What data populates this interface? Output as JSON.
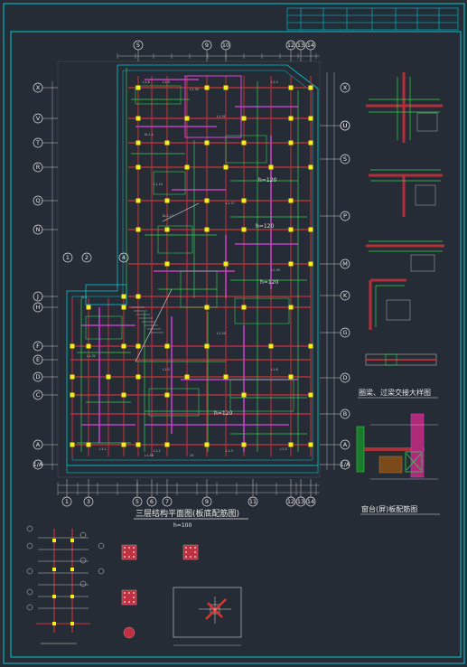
{
  "drawing": {
    "main_title": "三层结构平面图(板底配筋图)",
    "main_note": "h=100",
    "detail_title_1": "圈梁、过梁交接大样图",
    "detail_title_2": "窗台(屏)板配筋图",
    "slab_labels": [
      "h=120",
      "h=120",
      "h=120",
      "h=120"
    ]
  },
  "grid": {
    "top_axes": [
      "5",
      "9",
      "10",
      "12",
      "13",
      "14"
    ],
    "bottom_axes": [
      "1",
      "3",
      "5",
      "6",
      "7",
      "9",
      "11",
      "12",
      "13",
      "14"
    ],
    "left_axes": [
      "X",
      "V",
      "T",
      "R",
      "Q",
      "N",
      "J",
      "H",
      "F",
      "E",
      "D",
      "C",
      "A",
      "1/A"
    ],
    "right_axes": [
      "U",
      "S",
      "P",
      "M",
      "K",
      "G",
      "D",
      "B",
      "A",
      "1/A"
    ],
    "upper_left_axes": [
      "1",
      "2",
      "4"
    ]
  },
  "colors": {
    "background": "#262c36",
    "border": "#00c8d0",
    "wall": "#b0303a",
    "beam": "#c040c0",
    "rebar": "#30d050",
    "column": "#f0f020",
    "dimension": "#d0d0d0"
  }
}
